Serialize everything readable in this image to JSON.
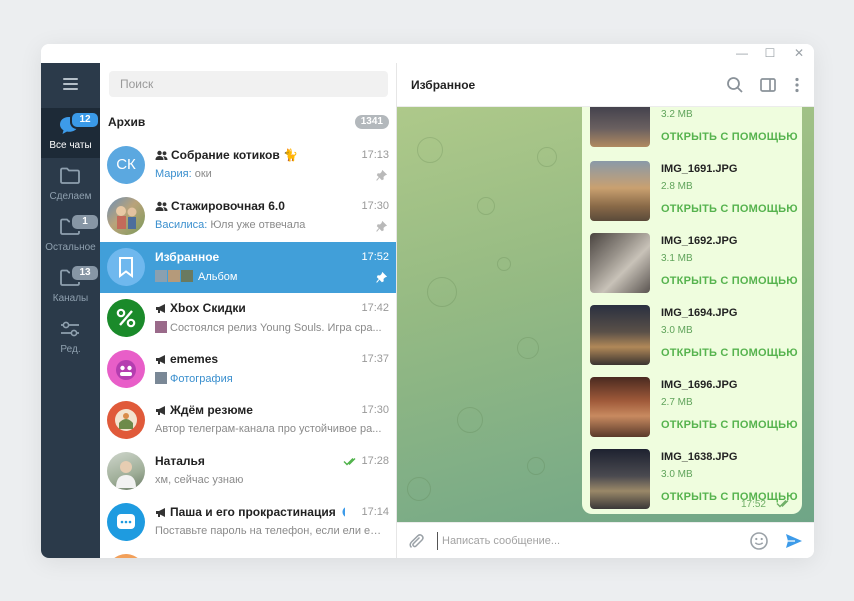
{
  "search": {
    "placeholder": "Поиск"
  },
  "folders": [
    {
      "label": "Все чаты",
      "badge": "12"
    },
    {
      "label": "Сделаем",
      "badge": ""
    },
    {
      "label": "Остальное",
      "badge": "1"
    },
    {
      "label": "Каналы",
      "badge": "13"
    },
    {
      "label": "Ред.",
      "badge": ""
    }
  ],
  "archive": {
    "title": "Архив",
    "count": "1341"
  },
  "chats": [
    {
      "name": "Собрание котиков 🐈",
      "time": "17:13",
      "sender": "Мария:",
      "preview": "оки",
      "avatar_text": "СК",
      "avatar_color": "#5ba8e0"
    },
    {
      "name": "Стажировочная 6.0",
      "time": "17:30",
      "sender": "Василиса:",
      "preview": "Юля уже отвечала"
    },
    {
      "name": "Избранное",
      "time": "17:52",
      "preview": "Альбом"
    },
    {
      "name": "Xbox Скидки",
      "time": "17:42",
      "preview": "Состоялся релиз Young Souls. Игра сра..."
    },
    {
      "name": "ememes",
      "time": "17:37",
      "preview": "Фотография"
    },
    {
      "name": "Ждём резюме",
      "time": "17:30",
      "preview": "Автор телеграм-канала про устойчивое ра..."
    },
    {
      "name": "Наталья",
      "time": "17:28",
      "preview": "хм, сейчас узнаю"
    },
    {
      "name": "Паша и его прокрастинация",
      "time": "17:14",
      "preview": "Поставьте пароль на телефон, если ели ещ..."
    }
  ],
  "chat": {
    "title": "Избранное",
    "top_size": "3.2 MB",
    "files": [
      {
        "name": "IMG_1691.JPG",
        "size": "2.8 MB",
        "action": "ОТКРЫТЬ С ПОМОЩЬЮ"
      },
      {
        "name": "IMG_1692.JPG",
        "size": "3.1 MB",
        "action": "ОТКРЫТЬ С ПОМОЩЬЮ"
      },
      {
        "name": "IMG_1694.JPG",
        "size": "3.0 MB",
        "action": "ОТКРЫТЬ С ПОМОЩЬЮ"
      },
      {
        "name": "IMG_1696.JPG",
        "size": "2.7 MB",
        "action": "ОТКРЫТЬ С ПОМОЩЬЮ"
      },
      {
        "name": "IMG_1638.JPG",
        "size": "3.0 MB",
        "action": "ОТКРЫТЬ С ПОМОЩЬЮ"
      }
    ],
    "top_action": "ОТКРЫТЬ С ПОМОЩЬЮ",
    "time": "17:52"
  },
  "composer": {
    "placeholder": "Написать сообщение..."
  },
  "colors": {
    "accent": "#419fd9",
    "sidebar": "#2b3a4a",
    "bubble": "#effdde",
    "link_green": "#56b34e"
  }
}
